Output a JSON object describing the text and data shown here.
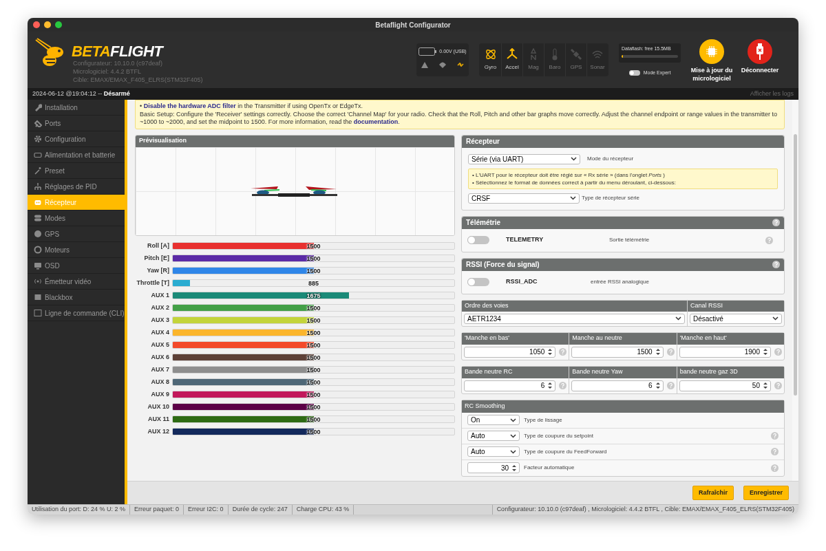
{
  "window": {
    "title": "Betaflight Configurator"
  },
  "header": {
    "logo": {
      "part_1": "BETA",
      "part_2": "FLIGHT"
    },
    "versions": [
      "Configurateur: 10.10.0 (c97deaf)",
      "Micrologiciel: 4.4.2 BTFL",
      "Cible: EMAX/EMAX_F405_ELRS(STM32F405)"
    ],
    "battery": "0.00V (USB)",
    "sensors": [
      {
        "label": "Gyro",
        "active": true
      },
      {
        "label": "Accel",
        "active": true
      },
      {
        "label": "Mag",
        "active": false
      },
      {
        "label": "Baro",
        "active": false
      },
      {
        "label": "GPS",
        "active": false
      },
      {
        "label": "Sonar",
        "active": false
      }
    ],
    "dataflash": {
      "label": "Dataflash: free 15.5MB",
      "level": 0.03
    },
    "expert_mode": {
      "label": "Mode Expert",
      "on": false
    },
    "buttons": [
      {
        "label": "Mise à jour du micrologiciel",
        "kind": "firmware"
      },
      {
        "label": "Déconnecter",
        "kind": "disconnect"
      }
    ]
  },
  "info_bar": {
    "status": "2024-06-12 @19:04:12 -- **Désarmé**",
    "logs": "Afficher les logs"
  },
  "sidebar": {
    "items": [
      {
        "label": "Installation",
        "selected": false
      },
      {
        "label": "Ports",
        "selected": false
      },
      {
        "label": "Configuration",
        "selected": false
      },
      {
        "label": "Alimentation et batterie",
        "selected": false
      },
      {
        "label": "Preset",
        "selected": false
      },
      {
        "label": "Réglages de PID",
        "selected": false
      },
      {
        "label": "Récepteur",
        "selected": true
      },
      {
        "label": "Modes",
        "selected": false
      },
      {
        "label": "GPS",
        "selected": false
      },
      {
        "label": "Moteurs",
        "selected": false
      },
      {
        "label": "OSD",
        "selected": false
      },
      {
        "label": "Émetteur vidéo",
        "selected": false
      },
      {
        "label": "Blackbox",
        "selected": false
      },
      {
        "label": "Ligne de commande (CLI)",
        "selected": false
      }
    ]
  },
  "note": {
    "bullet": "• **Disable the hardware ADC filter** in the Transmitter if using OpenTx or EdgeTx.",
    "text": "Basic Setup: Configure the 'Receiver' settings correctly. Choose the correct 'Channel Map' for your radio. Check that the Roll, Pitch and other bar graphs move correctly. Adjust the channel endpoint or range values in the transmitter to ~1000 to ~2000, and set the midpoint to 1500. For more information, read the",
    "link": "documentation",
    "end": "."
  },
  "preview": {
    "title": "Prévisualisation"
  },
  "channels": [
    {
      "name": "Roll [A]",
      "value": "1500",
      "level": 0.5,
      "color": "#e8302f"
    },
    {
      "name": "Pitch [E]",
      "value": "1500",
      "level": 0.5,
      "color": "#5b2aa6"
    },
    {
      "name": "Yaw [R]",
      "value": "1500",
      "level": 0.5,
      "color": "#2f86e8"
    },
    {
      "name": "Throttle [T]",
      "value": "885",
      "level": 0.06,
      "color": "#2aacd1"
    },
    {
      "name": "AUX 1",
      "value": "1675",
      "level": 0.625,
      "color": "#1b8a78"
    },
    {
      "name": "AUX 2",
      "value": "1500",
      "level": 0.5,
      "color": "#43a047"
    },
    {
      "name": "AUX 3",
      "value": "1500",
      "level": 0.5,
      "color": "#c3d43a"
    },
    {
      "name": "AUX 4",
      "value": "1500",
      "level": 0.5,
      "color": "#fbb52b"
    },
    {
      "name": "AUX 5",
      "value": "1500",
      "level": 0.5,
      "color": "#f34a2a"
    },
    {
      "name": "AUX 6",
      "value": "1500",
      "level": 0.5,
      "color": "#5d4037"
    },
    {
      "name": "AUX 7",
      "value": "1500",
      "level": 0.5,
      "color": "#8e8e8e"
    },
    {
      "name": "AUX 8",
      "value": "1500",
      "level": 0.5,
      "color": "#4e6777"
    },
    {
      "name": "AUX 9",
      "value": "1500",
      "level": 0.5,
      "color": "#c2185b"
    },
    {
      "name": "AUX 10",
      "value": "1500",
      "level": 0.5,
      "color": "#5c0046"
    },
    {
      "name": "AUX 11",
      "value": "1500",
      "level": 0.5,
      "color": "#2e6b14"
    },
    {
      "name": "AUX 12",
      "value": "1500",
      "level": 0.5,
      "color": "#13295c"
    }
  ],
  "receiver": {
    "title": "Récepteur",
    "mode": "Série (via UART)",
    "mode_label": "Mode du récepteur",
    "hints": [
      "• L'UART pour le récepteur doit être réglé sur « Rx série » (dans l'onglet *Ports* )",
      "• Sélectionnez le format de données correct à partir du menu déroulant, ci-dessous:"
    ],
    "serial_type": "CRSF",
    "serial_type_label": "Type de récepteur série"
  },
  "telemetry": {
    "title": "Télémétrie",
    "on": false,
    "name": "TELEMETRY",
    "description": "Sortie télémétrie"
  },
  "rssi": {
    "title": "RSSI (Force du signal)",
    "on": false,
    "name": "RSSI_ADC",
    "description": "entrée RSSI analogique"
  },
  "channel_map": {
    "title": "Ordre des voies",
    "value": "AETR1234",
    "rssi_title": "Canal RSSI",
    "rssi_value": "Désactivé"
  },
  "stick_fields": [
    {
      "title": "'Manche en bas'",
      "value": "1050"
    },
    {
      "title": "Manche au neutre",
      "value": "1500"
    },
    {
      "title": "'Manche en haut'",
      "value": "1900"
    }
  ],
  "deadband_fields": [
    {
      "title": "Bande neutre RC",
      "value": "6"
    },
    {
      "title": "Bande neutre Yaw",
      "value": "6"
    },
    {
      "title": "bande neutre gaz 3D",
      "value": "50"
    }
  ],
  "rc_smoothing": {
    "title": "RC Smoothing",
    "rows": [
      {
        "kind": "select",
        "value": "On",
        "label": "Type de lissage",
        "help": false
      },
      {
        "kind": "select",
        "value": "Auto",
        "label": "Type de coupure du setpoint",
        "help": true
      },
      {
        "kind": "select",
        "value": "Auto",
        "label": "Type de coupure du FeedForward",
        "help": true
      },
      {
        "kind": "number",
        "value": "30",
        "label": "Facteur automatique",
        "help": true
      }
    ]
  },
  "footer_buttons": [
    "Rafraîchir",
    "Enregistrer"
  ],
  "status_bar": {
    "items": [
      "Utilisation du port: D: 24 % U: 2 %",
      "Erreur paquet: 0",
      "Erreur I2C: 0",
      "Durée de cycle: 247",
      "Charge CPU: 43 %"
    ],
    "version": "Configurateur: 10.10.0 (c97deaf) , Micrologiciel: 4.4.2 BTFL , Cible: EMAX/EMAX_F405_ELRS(STM32F405)"
  }
}
